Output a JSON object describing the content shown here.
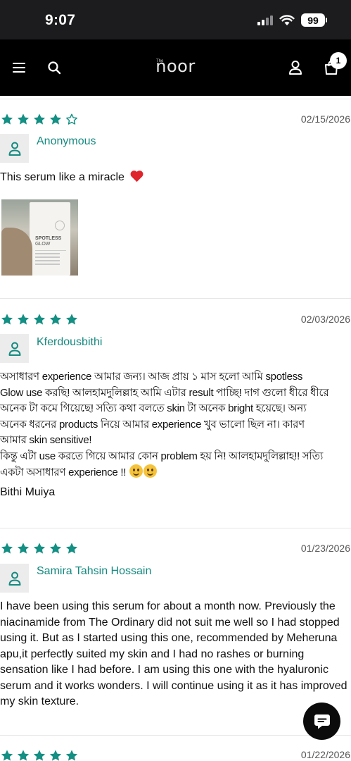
{
  "status_bar": {
    "time": "9:07",
    "battery": "99"
  },
  "nav": {
    "logo_small": "The",
    "logo": "noor",
    "cart_count": "1"
  },
  "colors": {
    "accent": "#158a80",
    "star": "#138f83",
    "nav_bg": "#000000"
  },
  "reviews": [
    {
      "rating": 4,
      "date": "02/15/2026",
      "author": "Anonymous",
      "text_lines": [
        "This serum like a miracle"
      ],
      "emoji": "red-heart",
      "photo": {
        "title_line1": "SPOTLESS",
        "title_line2": "GLOW"
      }
    },
    {
      "rating": 5,
      "date": "02/03/2026",
      "author": "Kferdousbithi",
      "text_lines": [
        "অসাধারণ experience আমার জন্য। আজ প্রায় ১ মাস হলো আমি spotless",
        "Glow use করছি! আলহামদুলিল্লাহ আমি এটার result পাচ্ছি! দাগ গুলো ধীরে ধীরে",
        "অনেক টা কমে গিয়েছে! সত্যি কথা বলতে skin টা অনেক bright হয়েছে। অন্য",
        "অনেক ধরনের products নিয়ে আমার experience খুব ভালো ছিল না। কারণ",
        "আমার skin sensitive!",
        "কিন্তু এটা use করতে গিয়ে আমার কোন problem হয় নি! আলহামদুলিল্লাহ!! সত্যি",
        "একটা অসাধারণ experience !!"
      ],
      "signature": "Bithi Muiya"
    },
    {
      "rating": 5,
      "date": "01/23/2026",
      "author": "Samira Tahsin Hossain",
      "text_lines": [
        "I have been using this serum for about a month now. Previously the",
        "niacinamide from The Ordinary did not suit me well so I had stopped",
        "using it. But as I started using this one, recommended by Meheruna",
        "apu,it perfectly suited my skin and I had no rashes or burning",
        "sensation like I had before. I am using this one with the hyaluronic",
        "serum and it works wonders. I will continue using it as it has improved",
        "my skin texture."
      ]
    },
    {
      "rating": 5,
      "date": "01/22/2026"
    }
  ]
}
